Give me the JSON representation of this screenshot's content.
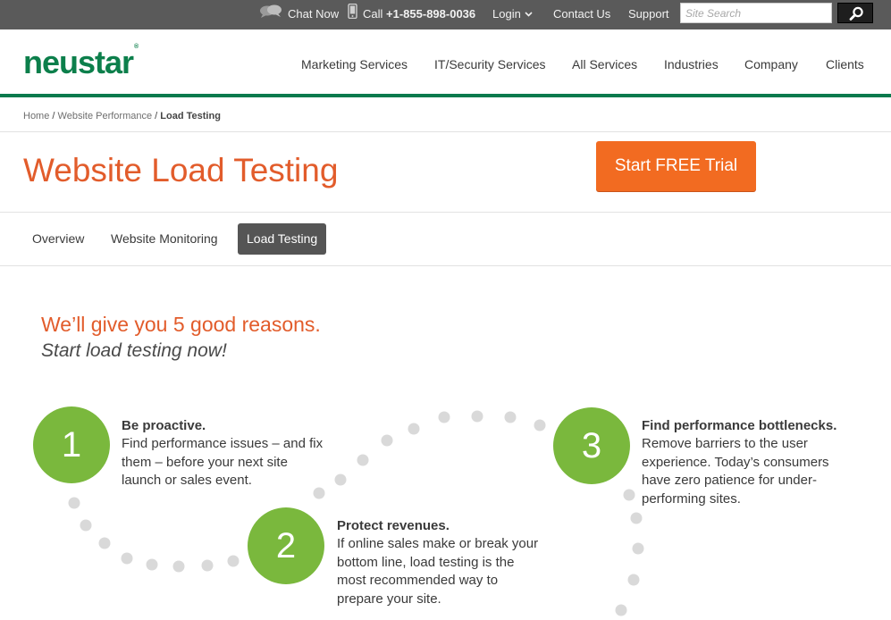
{
  "topbar": {
    "chat_label": "Chat Now",
    "call_label": "Call",
    "phone": "+1-855-898-0036",
    "login_label": "Login",
    "contact_label": "Contact Us",
    "support_label": "Support",
    "search_placeholder": "Site Search"
  },
  "header": {
    "logo": "neustar",
    "logo_mark": "®",
    "nav": [
      "Marketing Services",
      "IT/Security Services",
      "All Services",
      "Industries",
      "Company",
      "Clients"
    ]
  },
  "breadcrumb": {
    "items": [
      "Home",
      "Website Performance"
    ],
    "separator": "/",
    "current": "Load Testing"
  },
  "page": {
    "title": "Website Load Testing",
    "cta": "Start FREE Trial"
  },
  "tabs": [
    {
      "label": "Overview",
      "active": false
    },
    {
      "label": "Website Monitoring",
      "active": false
    },
    {
      "label": "Load Testing",
      "active": true
    }
  ],
  "reasons": {
    "headline": "We’ll give you 5 good reasons.",
    "subhead": "Start load testing now!",
    "steps": [
      {
        "number": "1",
        "title": "Be proactive.",
        "lines": [
          "Find performance issues – and fix",
          "them – before your next site",
          "launch or sales event."
        ]
      },
      {
        "number": "2",
        "title": "Protect revenues.",
        "lines": [
          "If online sales make or break your",
          "bottom line, load testing is the",
          "most recommended way to",
          "prepare your site."
        ]
      },
      {
        "number": "3",
        "title": "Find performance bottlenecks.",
        "lines": [
          "Remove barriers to the user",
          "experience. Today’s consumers",
          "have zero patience for under-",
          "performing sites."
        ]
      }
    ]
  },
  "colors": {
    "topbar": "#5a5a5a",
    "brand_green": "#0c7f4b",
    "accent_orange": "#e25c2b",
    "cta_orange": "#f26b21",
    "circle_green": "#7ab83d",
    "dot_gray": "#d9d9d9"
  },
  "icons": [
    "chat-icon",
    "phone-icon",
    "chevron-down-icon",
    "search-icon"
  ]
}
